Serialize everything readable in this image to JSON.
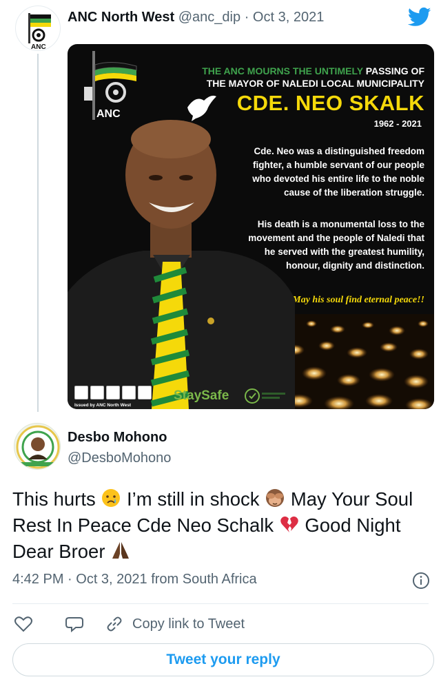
{
  "parent_tweet": {
    "author_name": "ANC North West",
    "handle": "@anc_dip",
    "separator": "·",
    "date": "Oct 3, 2021",
    "poster": {
      "logo_text": "ANC",
      "headline_green": "THE ANC MOURNS THE UNTIMELY",
      "headline_white_1": "PASSING OF",
      "headline_white_2": "THE MAYOR OF NALEDI LOCAL MUNICIPALITY",
      "honoree": "CDE. NEO SKALK",
      "years": "1962 - 2021",
      "paragraph_1": "Cde. Neo was a distinguished freedom fighter, a humble servant of our people who devoted his entire life to the noble cause of the liberation struggle.",
      "paragraph_2": "His death is a monumental loss to the movement and the people of Naledi that he served with the greatest humility, honour, dignity and distinction.",
      "closing": "May his soul find eternal peace!!",
      "issued_by": "Issued by ANC North West",
      "stay_safe": "StaySafe"
    }
  },
  "reply_tweet": {
    "author_name": "Desbo Mohono",
    "handle": "@DesboMohono",
    "text_1": "This hurts ",
    "text_2": " I’m still in shock ",
    "text_3": " May Your Soul Rest In Peace Cde Neo Schalk ",
    "text_4": " Good Night Dear Broer ",
    "emojis": [
      "crying-face-icon",
      "see-no-evil-monkey-icon",
      "broken-heart-icon",
      "folded-hands-icon"
    ],
    "timestamp": "4:42 PM · Oct 3, 2021 from South Africa"
  },
  "actions": {
    "copy_link_label": "Copy link to Tweet",
    "reply_button_label": "Tweet your reply"
  },
  "colors": {
    "twitter_blue": "#1d9bf0",
    "anc_green": "#3fa34d",
    "anc_yellow": "#f5d90a",
    "muted_text": "#536471"
  }
}
